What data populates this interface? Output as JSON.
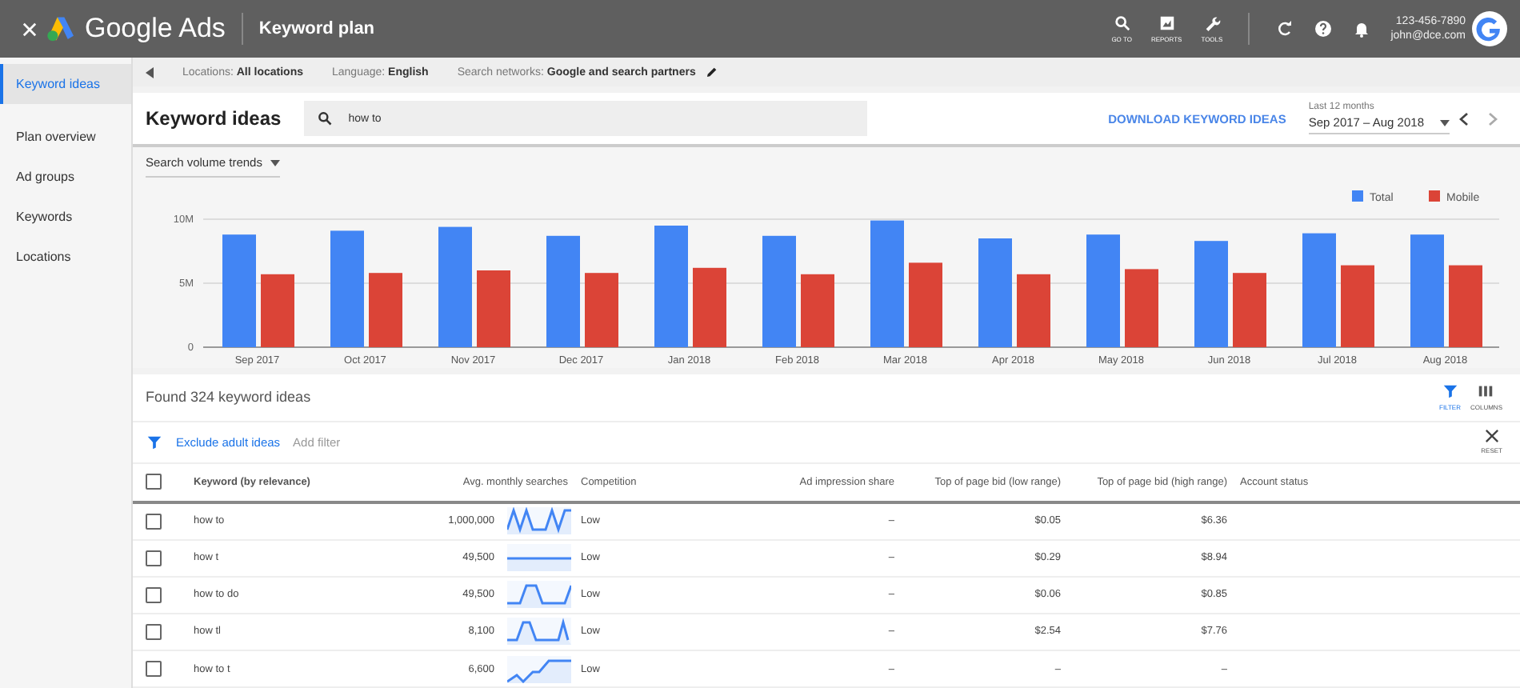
{
  "top_bar": {
    "product": "Google Ads",
    "page_title": "Keyword plan",
    "tools": [
      {
        "kind": "search",
        "label": "GO TO"
      },
      {
        "kind": "reports",
        "label": "REPORTS"
      },
      {
        "kind": "tools",
        "label": "TOOLS"
      }
    ],
    "account": {
      "phone": "123-456-7890",
      "email": "john@dce.com"
    }
  },
  "sidebar": {
    "items": [
      {
        "label": "Keyword ideas",
        "selected": true
      },
      {
        "label": "Plan overview",
        "selected": false
      },
      {
        "label": "Ad groups",
        "selected": false
      },
      {
        "label": "Keywords",
        "selected": false
      },
      {
        "label": "Locations",
        "selected": false
      }
    ]
  },
  "targeting_bar": [
    {
      "label": "Locations:",
      "value": "All locations"
    },
    {
      "label": "Language:",
      "value": "English"
    },
    {
      "label": "Search networks:",
      "value": "Google and search partners"
    }
  ],
  "header": {
    "title": "Keyword ideas",
    "search": {
      "value": "how to"
    },
    "download": "DOWNLOAD KEYWORD IDEAS",
    "date_range": {
      "label": "Last 12 months",
      "value": "Sep 2017 – Aug 2018"
    }
  },
  "trends": {
    "dropdown": "Search volume trends",
    "chart_data": {
      "type": "bar",
      "legend": "top-right",
      "categories": [
        "Sep 2017",
        "Oct 2017",
        "Nov 2017",
        "Dec 2017",
        "Jan 2018",
        "Feb 2018",
        "Mar 2018",
        "Apr 2018",
        "May 2018",
        "Jun 2018",
        "Jul 2018",
        "Aug 2018"
      ],
      "ylim": [
        0,
        10000000
      ],
      "yticks": [
        {
          "value": 0,
          "label": "0"
        },
        {
          "value": 5000000,
          "label": "5M"
        },
        {
          "value": 10000000,
          "label": "10M"
        }
      ],
      "series": [
        {
          "name": "Total",
          "color": "#4285f4",
          "values": [
            8800000,
            9100000,
            9400000,
            8700000,
            9500000,
            8700000,
            9900000,
            8500000,
            8800000,
            8300000,
            8900000,
            8800000
          ]
        },
        {
          "name": "Mobile",
          "color": "#db4437",
          "values": [
            5700000,
            5800000,
            6000000,
            5800000,
            6200000,
            5700000,
            6600000,
            5700000,
            6100000,
            5800000,
            6400000,
            6400000
          ]
        }
      ]
    }
  },
  "results": {
    "count": "Found 324 keyword ideas",
    "actions": [
      {
        "kind": "filter",
        "label": "FILTER",
        "active": true
      },
      {
        "kind": "columns",
        "label": "COLUMNS",
        "active": false
      }
    ],
    "filters": {
      "applied": "Exclude adult ideas",
      "add": "Add filter",
      "reset": "RESET"
    },
    "table": {
      "select_all": {
        "checked": false
      },
      "columns": [
        "Keyword (by relevance)",
        "Avg. monthly searches",
        "Competition",
        "Ad impression share",
        "Top of page bid (low range)",
        "Top of page bid (high range)",
        "Account status"
      ],
      "rows": [
        {
          "checked": false,
          "cells": [
            "how to",
            "1,000,000",
            "Low",
            "–",
            "$0.05",
            "$6.36"
          ]
        },
        {
          "checked": false,
          "cells": [
            "how t",
            "49,500",
            "Low",
            "–",
            "$0.29",
            "$8.94"
          ]
        },
        {
          "checked": false,
          "cells": [
            "how to do",
            "49,500",
            "Low",
            "–",
            "$0.06",
            "$0.85"
          ]
        },
        {
          "checked": false,
          "cells": [
            "how tl",
            "8,100",
            "Low",
            "–",
            "$2.54",
            "$7.76"
          ]
        },
        {
          "checked": false,
          "cells": [
            "how to t",
            "6,600",
            "Low",
            "–",
            "–",
            "–"
          ]
        }
      ]
    }
  }
}
